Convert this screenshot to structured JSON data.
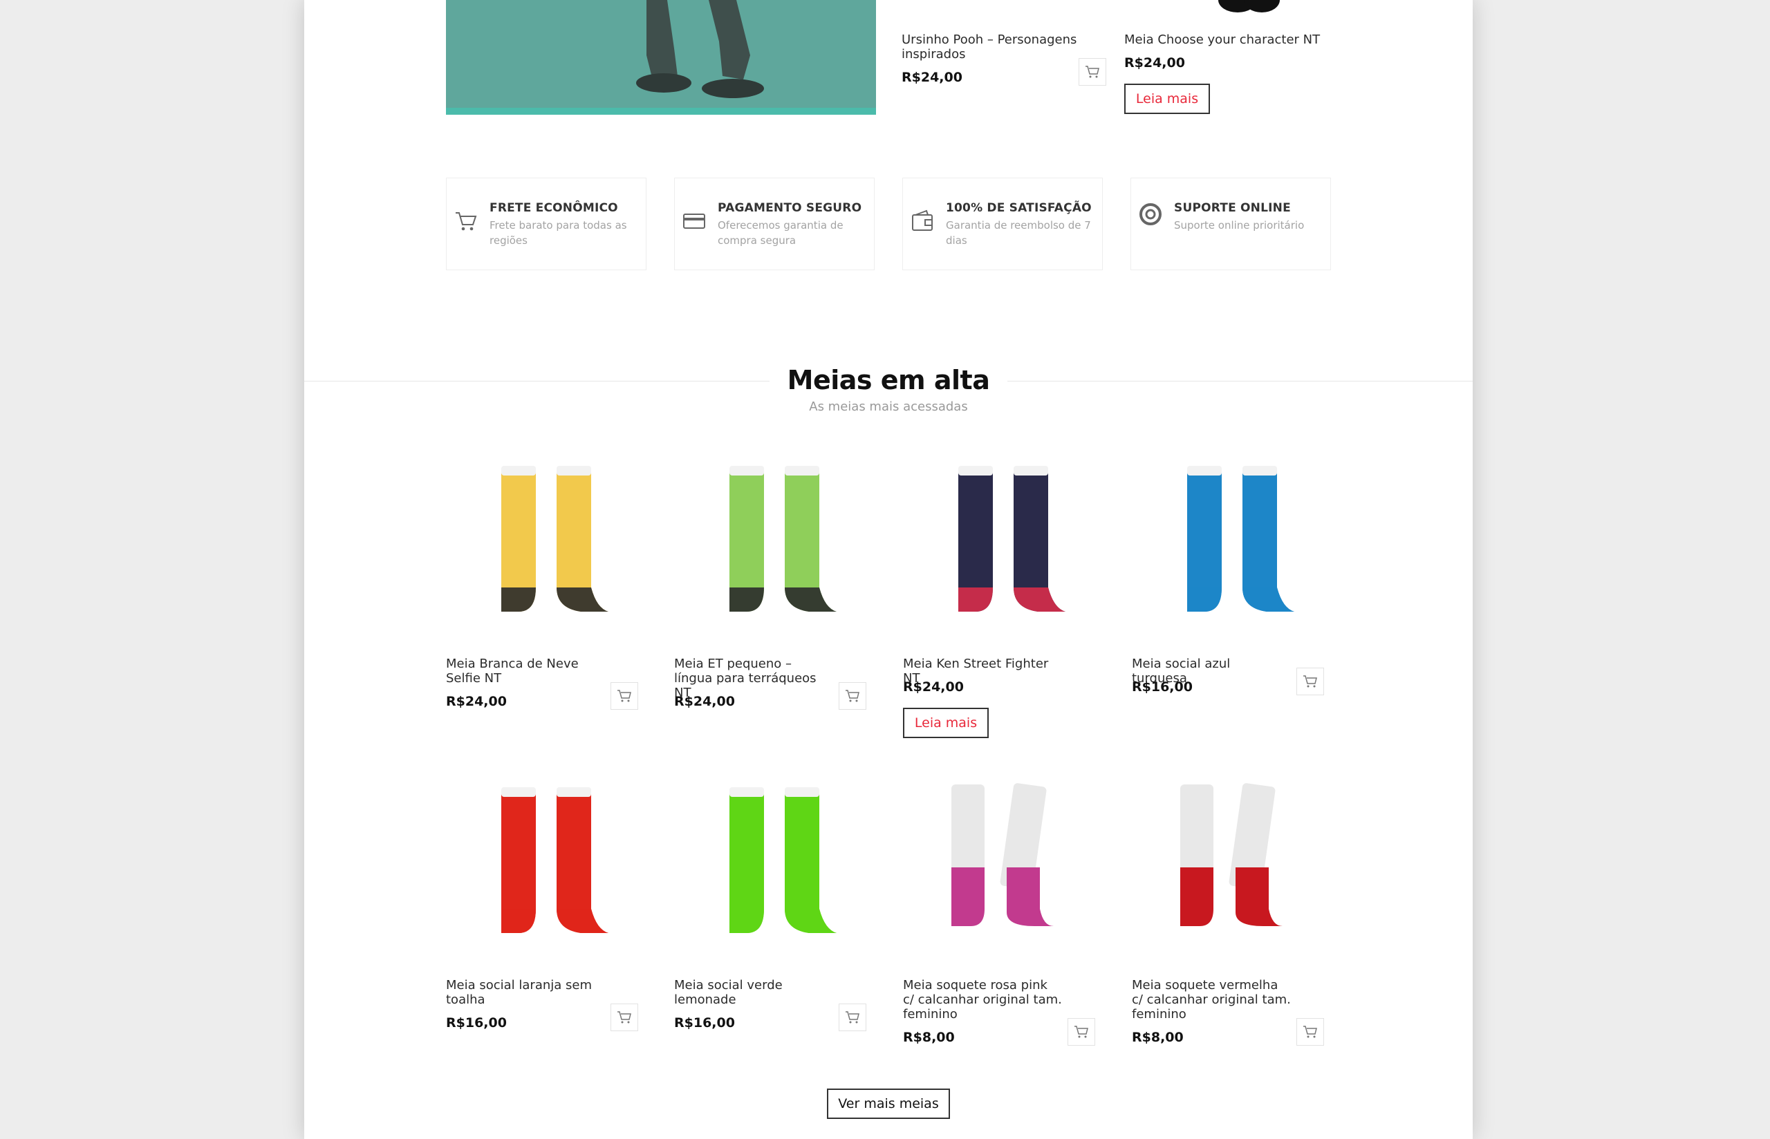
{
  "top_products": [
    {
      "name": "Ursinho Pooh – Personagens inspirados",
      "price": "R$24,00",
      "action": "cart"
    },
    {
      "name": "Meia Choose your character NT",
      "price": "R$24,00",
      "action": "Leia mais"
    }
  ],
  "features": [
    {
      "icon": "cart-icon",
      "title": "FRETE ECONÔMICO",
      "desc": "Frete barato para todas as regiões"
    },
    {
      "icon": "credit-card-icon",
      "title": "PAGAMENTO SEGURO",
      "desc": "Oferecemos garantia de compra segura"
    },
    {
      "icon": "wallet-icon",
      "title": "100% DE SATISFAÇÃO",
      "desc": "Garantia de reembolso de 7 dias"
    },
    {
      "icon": "lifebuoy-icon",
      "title": "SUPORTE ONLINE",
      "desc": "Suporte online prioritário"
    }
  ],
  "section": {
    "title": "Meias em alta",
    "subtitle": "As meias mais acessadas"
  },
  "products": [
    {
      "name": "Meia Branca de Neve Selfie NT",
      "price": "R$24,00",
      "action": "cart",
      "colors": [
        "#f2c94c",
        "#2b2b2b"
      ]
    },
    {
      "name": "Meia ET pequeno – língua para terráqueos NT",
      "price": "R$24,00",
      "action": "cart",
      "colors": [
        "#8fcf5a",
        "#2b2b2b"
      ]
    },
    {
      "name": "Meia Ken Street Fighter NT",
      "price": "R$24,00",
      "action": "Leia mais",
      "colors": [
        "#2a2a4a",
        "#d62c4a"
      ]
    },
    {
      "name": "Meia social azul turquesa",
      "price": "R$16,00",
      "action": "cart",
      "colors": [
        "#1d86c8",
        "#1d86c8"
      ]
    },
    {
      "name": "Meia social laranja sem toalha",
      "price": "R$16,00",
      "action": "cart",
      "colors": [
        "#e0261b",
        "#e0261b"
      ]
    },
    {
      "name": "Meia social verde lemonade",
      "price": "R$16,00",
      "action": "cart",
      "colors": [
        "#5fd615",
        "#5fd615"
      ]
    },
    {
      "name": "Meia soquete rosa pink c/ calcanhar original tam. feminino",
      "price": "R$8,00",
      "action": "cart",
      "colors": [
        "#c23a8e",
        "#e6e6e6"
      ]
    },
    {
      "name": "Meia soquete vermelha c/ calcanhar original tam. feminino",
      "price": "R$8,00",
      "action": "cart",
      "colors": [
        "#c8181f",
        "#e6e6e6"
      ]
    }
  ],
  "more_button": "Ver mais meias"
}
